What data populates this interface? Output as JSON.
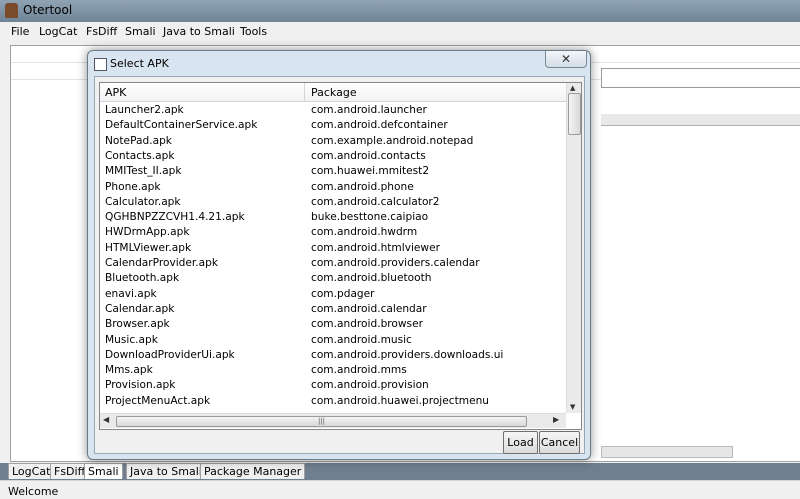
{
  "window": {
    "title": "Otertool"
  },
  "menu": [
    "File",
    "LogCat",
    "FsDiff",
    "Smali",
    "Java to Smali",
    "Tools"
  ],
  "tabs": [
    "LogCat",
    "FsDiff",
    "Smali",
    "Java to Smali",
    "Package Manager"
  ],
  "status": {
    "text": "Welcome"
  },
  "dialog": {
    "title": "Select APK",
    "close": "✕",
    "columns": [
      "APK",
      "Package"
    ],
    "rows": [
      [
        "Launcher2.apk",
        "com.android.launcher"
      ],
      [
        "DefaultContainerService.apk",
        "com.android.defcontainer"
      ],
      [
        "NotePad.apk",
        "com.example.android.notepad"
      ],
      [
        "Contacts.apk",
        "com.android.contacts"
      ],
      [
        "MMITest_II.apk",
        "com.huawei.mmitest2"
      ],
      [
        "Phone.apk",
        "com.android.phone"
      ],
      [
        "Calculator.apk",
        "com.android.calculator2"
      ],
      [
        "QGHBNPZZCVH1.4.21.apk",
        "buke.besttone.caipiao"
      ],
      [
        "HWDrmApp.apk",
        "com.android.hwdrm"
      ],
      [
        "HTMLViewer.apk",
        "com.android.htmlviewer"
      ],
      [
        "CalendarProvider.apk",
        "com.android.providers.calendar"
      ],
      [
        "Bluetooth.apk",
        "com.android.bluetooth"
      ],
      [
        "enavi.apk",
        "com.pdager"
      ],
      [
        "Calendar.apk",
        "com.android.calendar"
      ],
      [
        "Browser.apk",
        "com.android.browser"
      ],
      [
        "Music.apk",
        "com.android.music"
      ],
      [
        "DownloadProviderUi.apk",
        "com.android.providers.downloads.ui"
      ],
      [
        "Mms.apk",
        "com.android.mms"
      ],
      [
        "Provision.apk",
        "com.android.provision"
      ],
      [
        "ProjectMenuAct.apk",
        "com.android.huawei.projectmenu"
      ]
    ],
    "load_label": "Load",
    "cancel_label": "Cancel"
  }
}
